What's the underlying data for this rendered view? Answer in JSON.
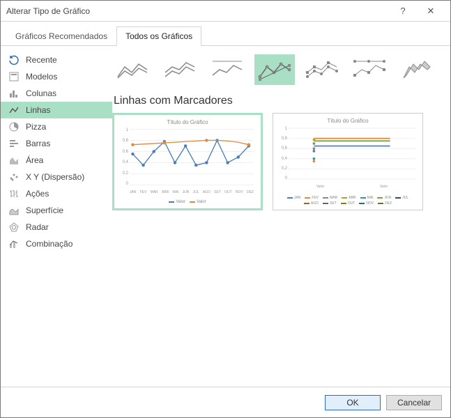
{
  "window": {
    "title": "Alterar Tipo de Gráfico",
    "help": "?",
    "close": "✕"
  },
  "tabs": {
    "recommended": "Gráficos Recomendados",
    "all": "Todos os Gráficos"
  },
  "sidebar": {
    "items": [
      {
        "label": "Recente"
      },
      {
        "label": "Modelos"
      },
      {
        "label": "Colunas"
      },
      {
        "label": "Linhas"
      },
      {
        "label": "Pizza"
      },
      {
        "label": "Barras"
      },
      {
        "label": "Área"
      },
      {
        "label": "X Y (Dispersão)"
      },
      {
        "label": "Ações"
      },
      {
        "label": "Superfície"
      },
      {
        "label": "Radar"
      },
      {
        "label": "Combinação"
      }
    ]
  },
  "section_title": "Linhas com Marcadores",
  "preview1": {
    "title": "Título do Gráfico",
    "legend": {
      "a": "Valor",
      "b": "Valor"
    }
  },
  "preview2": {
    "title": "Título do Gráfico",
    "xlabels": {
      "a": "Valor",
      "b": "Valor"
    }
  },
  "footer": {
    "ok": "OK",
    "cancel": "Cancelar"
  },
  "chart_data": [
    {
      "type": "line",
      "title": "Título do Gráfico",
      "categories": [
        "JAN",
        "FEV",
        "MAR",
        "ABR",
        "MAI",
        "JUN",
        "JUL",
        "AGO",
        "SET",
        "OUT",
        "NOV",
        "DEZ"
      ],
      "series": [
        {
          "name": "Valor",
          "color": "#4a7ebb",
          "values": [
            0.55,
            0.35,
            0.6,
            0.78,
            0.4,
            0.7,
            0.35,
            0.4,
            0.8,
            0.4,
            0.5,
            0.7
          ]
        },
        {
          "name": "Valor",
          "color": "#e08b3a",
          "values": [
            0.72,
            0.73,
            0.74,
            0.76,
            0.77,
            0.78,
            0.79,
            0.8,
            0.8,
            0.79,
            0.77,
            0.72
          ]
        }
      ],
      "ylabel": "",
      "xlabel": "",
      "ylim": [
        0,
        1
      ],
      "yticks": [
        0,
        0.2,
        0.4,
        0.6,
        0.8,
        1
      ]
    },
    {
      "type": "line",
      "title": "Título do Gráfico",
      "categories": [
        "Valor",
        "Valor"
      ],
      "series": [
        {
          "name": "JAN",
          "values": [
            0.55,
            0.72
          ]
        },
        {
          "name": "FEV",
          "values": [
            0.35,
            0.73
          ]
        },
        {
          "name": "MAR",
          "values": [
            0.6,
            0.74
          ]
        },
        {
          "name": "ABR",
          "values": [
            0.78,
            0.76
          ]
        },
        {
          "name": "MAI",
          "values": [
            0.4,
            0.77
          ]
        },
        {
          "name": "JUN",
          "values": [
            0.7,
            0.78
          ]
        },
        {
          "name": "JUL",
          "values": [
            0.35,
            0.79
          ]
        },
        {
          "name": "AGO",
          "values": [
            0.4,
            0.8
          ]
        },
        {
          "name": "SET",
          "values": [
            0.8,
            0.8
          ]
        },
        {
          "name": "OUT",
          "values": [
            0.4,
            0.79
          ]
        },
        {
          "name": "NOV",
          "values": [
            0.5,
            0.77
          ]
        },
        {
          "name": "DEZ",
          "values": [
            0.7,
            0.72
          ]
        }
      ],
      "legend_entries": [
        "JAN",
        "FEV",
        "MAR",
        "ABR",
        "MAI",
        "JUN",
        "JUL",
        "AGO",
        "SET",
        "OUT",
        "NOV",
        "DEZ"
      ],
      "ylabel": "",
      "xlabel": "",
      "ylim": [
        0,
        1
      ],
      "yticks": [
        0,
        0.2,
        0.4,
        0.6,
        0.8,
        1
      ]
    }
  ],
  "yticks": {
    "t0": "0",
    "t1": "0,2",
    "t2": "0,4",
    "t3": "0,6",
    "t4": "0,8",
    "t5": "1"
  },
  "months": {
    "m0": "JAN",
    "m1": "FEV",
    "m2": "MAR",
    "m3": "ABR",
    "m4": "MAI",
    "m5": "JUN",
    "m6": "JUL",
    "m7": "AGO",
    "m8": "SET",
    "m9": "OUT",
    "m10": "NOV",
    "m11": "DEZ"
  }
}
